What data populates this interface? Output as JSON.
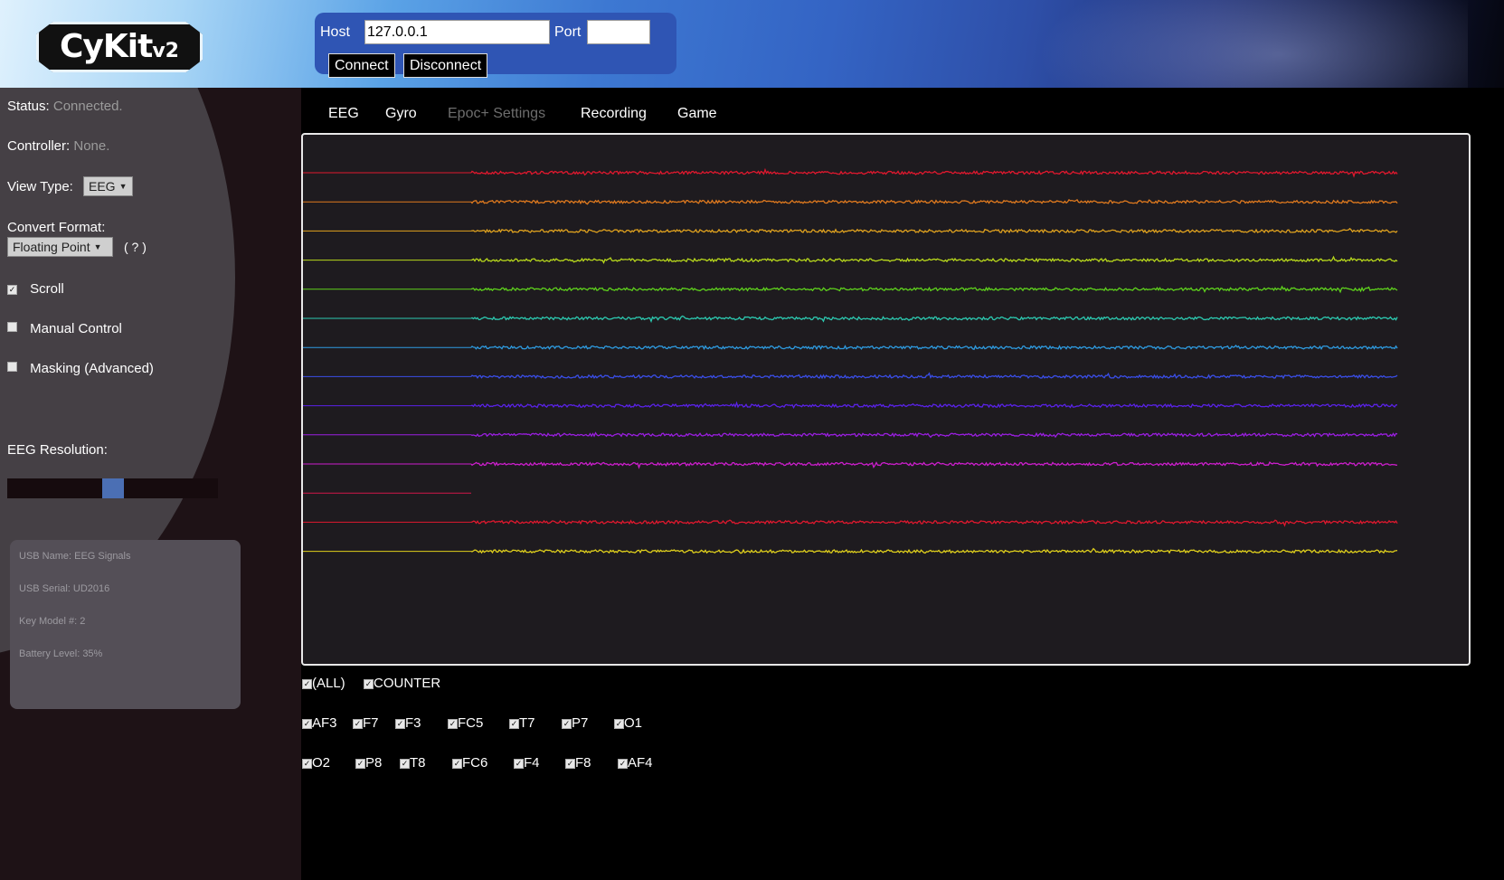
{
  "header": {
    "logo_main": "CyKit",
    "logo_version": "v2",
    "host_label": "Host",
    "host_value": "127.0.0.1",
    "port_label": "Port",
    "port_value": "",
    "connect_label": "Connect",
    "disconnect_label": "Disconnect"
  },
  "sidebar": {
    "status_label": "Status:",
    "status_value": "Connected.",
    "controller_label": "Controller:",
    "controller_value": "None.",
    "view_type_label": "View Type:",
    "view_type_value": "EEG",
    "convert_format_label": "Convert Format:",
    "convert_format_value": "Floating Point",
    "help_label": "( ? )",
    "scroll_label": "Scroll",
    "scroll_checked": true,
    "manual_control_label": "Manual Control",
    "manual_control_checked": false,
    "masking_label": "Masking (Advanced)",
    "masking_checked": false,
    "eeg_resolution_label": "EEG Resolution:",
    "eeg_resolution_fraction": 0.5,
    "info": {
      "usb_name": "USB Name: EEG Signals",
      "usb_serial": "USB Serial: UD2016",
      "key_model": "Key Model #: 2",
      "battery": "Battery Level: 35%"
    }
  },
  "tabs": [
    {
      "label": "EEG",
      "enabled": true
    },
    {
      "label": "Gyro",
      "enabled": true
    },
    {
      "label": "Epoc+ Settings",
      "enabled": false
    },
    {
      "label": "Recording",
      "enabled": true
    },
    {
      "label": "Game",
      "enabled": true
    }
  ],
  "channels": {
    "all_label": "(ALL)",
    "counter_label": "COUNTER",
    "row1": [
      "AF3",
      "F7",
      "F3",
      "FC5",
      "T7",
      "P7",
      "O1"
    ],
    "row2": [
      "O2",
      "P8",
      "T8",
      "FC6",
      "F4",
      "F8",
      "AF4"
    ]
  },
  "traces": {
    "colors": [
      "#e0182e",
      "#e07a1e",
      "#e0a21e",
      "#b8d81c",
      "#5ed11c",
      "#2cc9b0",
      "#2e9be0",
      "#3a4ee8",
      "#5a22e8",
      "#9a1ee0",
      "#cc1ecc",
      "#d0184a",
      "#e0182e",
      "#e0d01c"
    ],
    "flat_only": [
      false,
      false,
      false,
      false,
      false,
      false,
      false,
      false,
      false,
      false,
      false,
      true,
      false,
      false
    ]
  }
}
